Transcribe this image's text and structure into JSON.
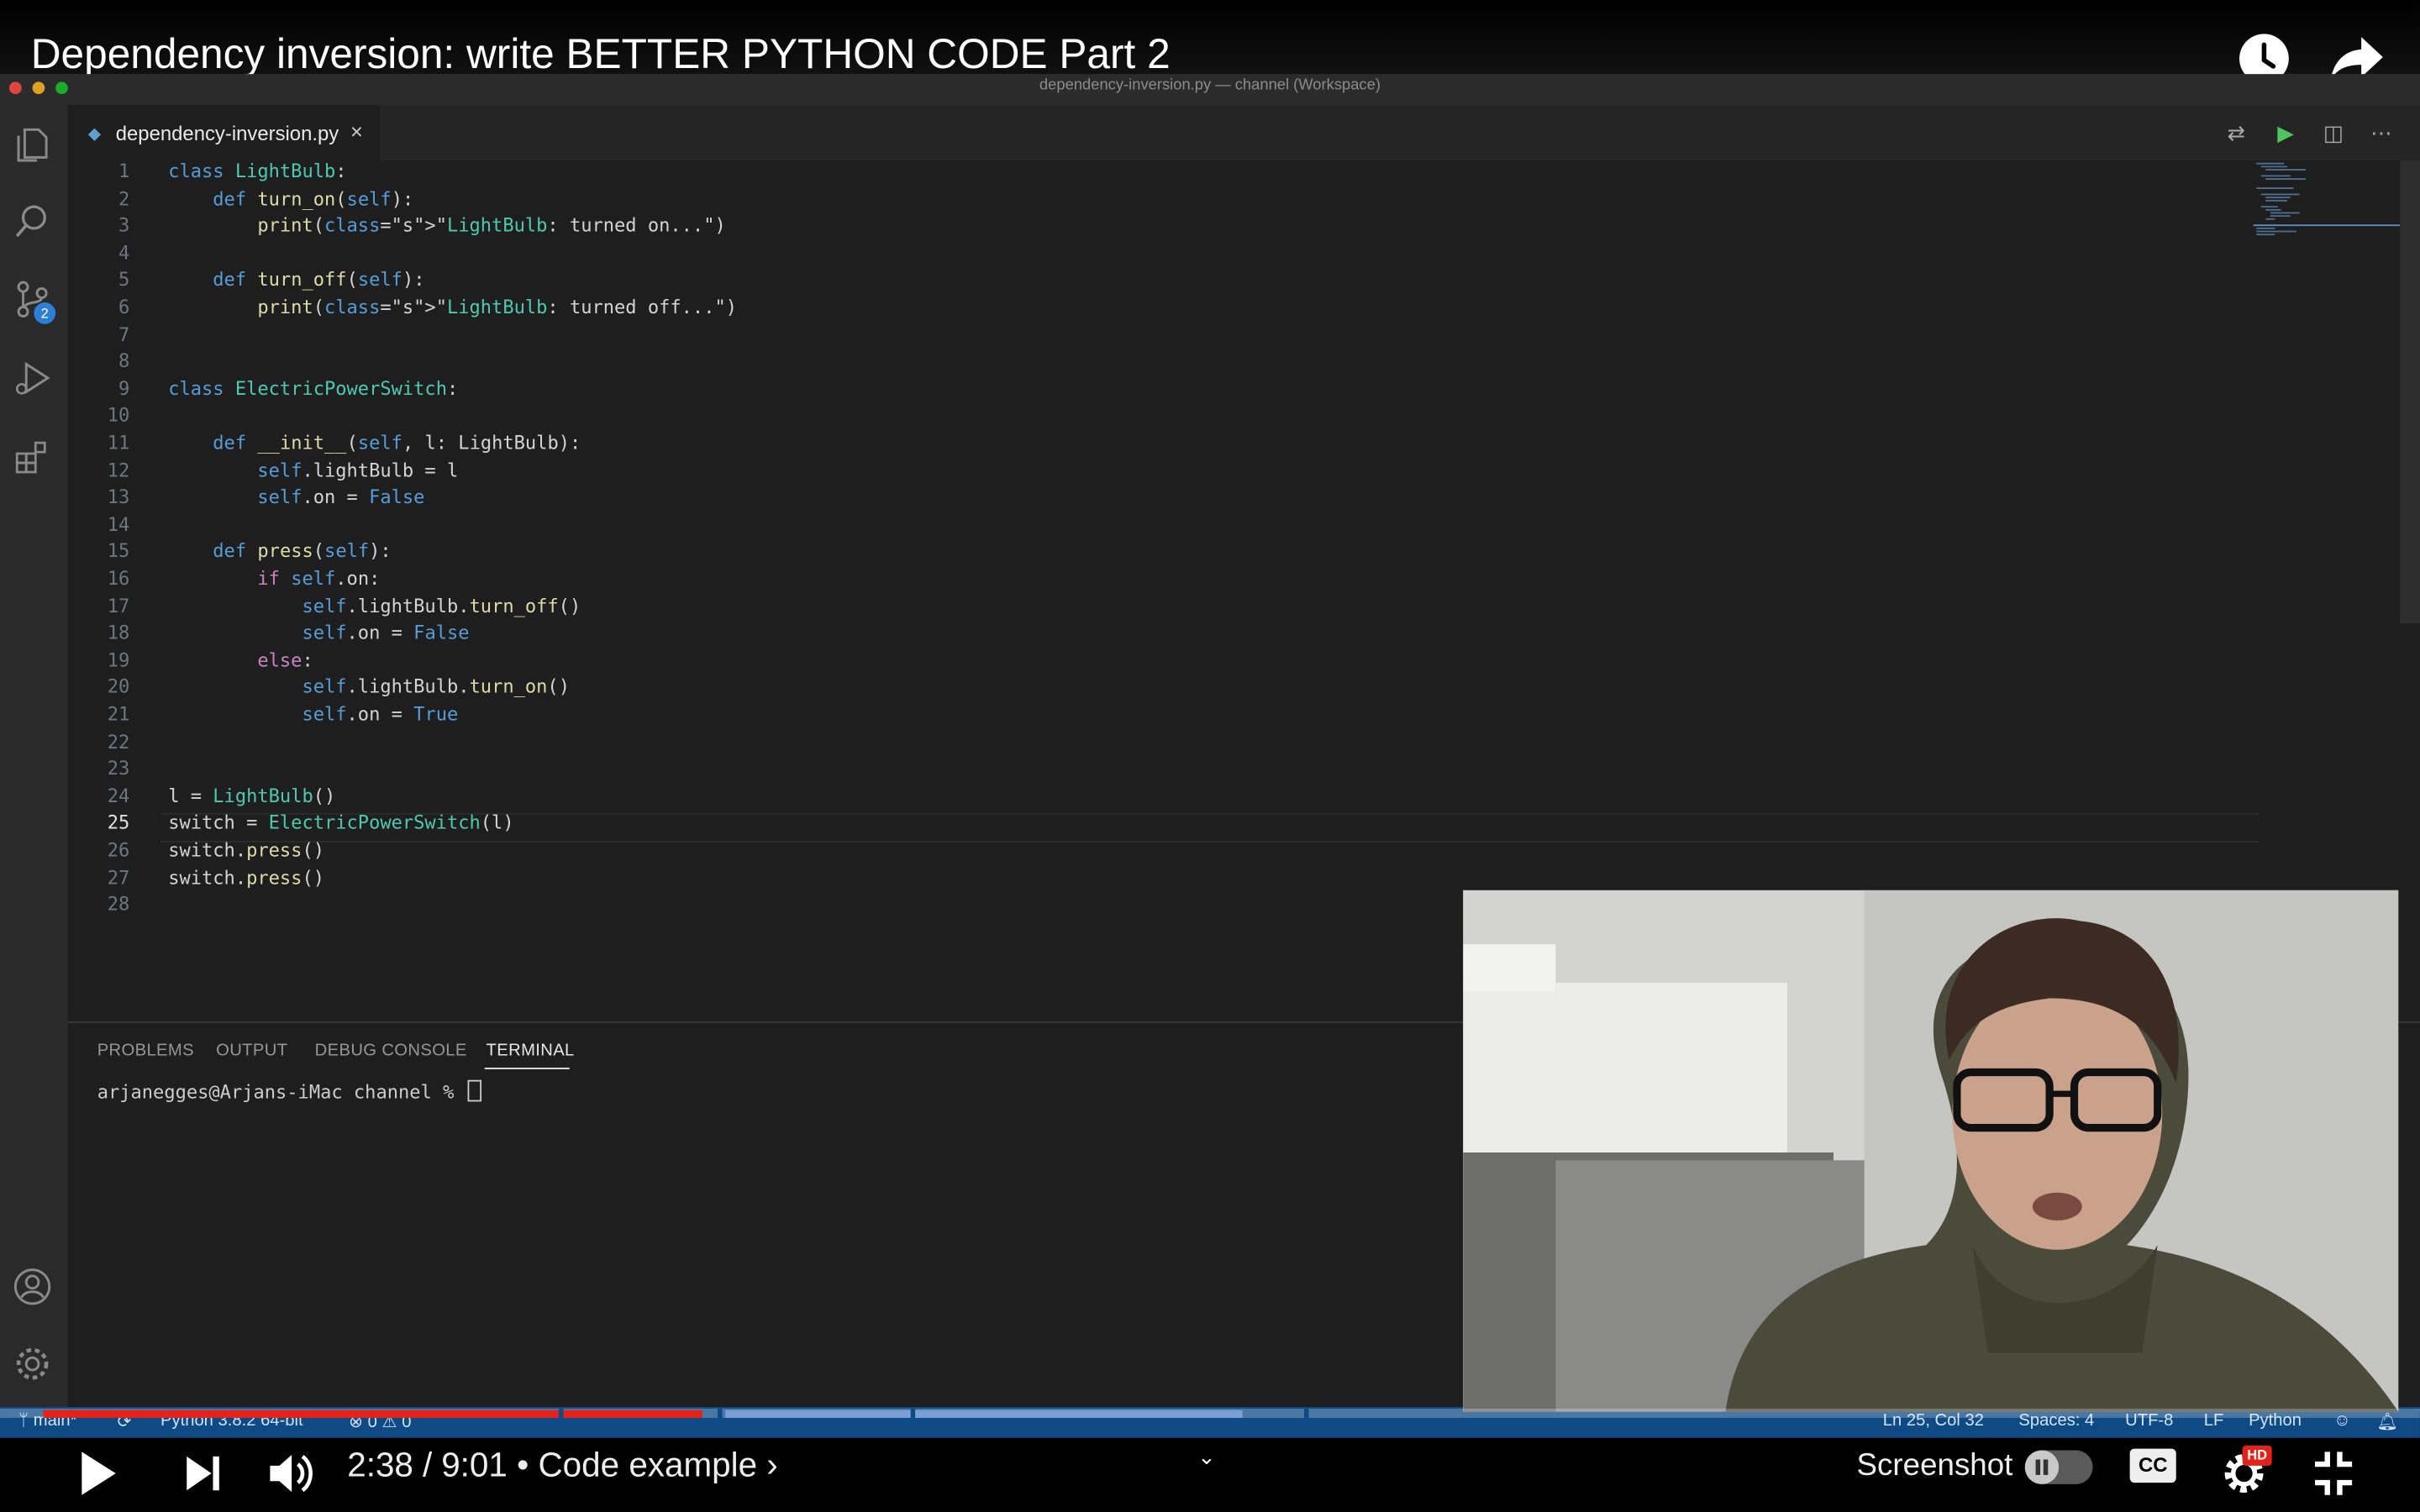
{
  "video": {
    "title": "Dependency inversion: write BETTER PYTHON CODE Part 2",
    "time_current": "2:38",
    "time_separator": "/",
    "time_total": "9:01",
    "chapter": "• Code example ›",
    "screenshot_label": "Screenshot",
    "cc_label": "CC",
    "hd_label": "HD",
    "progress_played": 0.29
  },
  "window": {
    "title": "dependency-inversion.py — channel (Workspace)"
  },
  "activity_bar": {
    "scm_badge": "2",
    "icons": [
      "files-icon",
      "search-icon",
      "source-control-icon",
      "run-debug-icon",
      "extensions-icon",
      "account-icon",
      "settings-gear-icon"
    ]
  },
  "editor": {
    "tab_label": "dependency-inversion.py",
    "tab_close": "×",
    "line_numbers": [
      "1",
      "2",
      "3",
      "4",
      "5",
      "6",
      "7",
      "8",
      "9",
      "10",
      "11",
      "12",
      "13",
      "14",
      "15",
      "16",
      "17",
      "18",
      "19",
      "20",
      "21",
      "22",
      "23",
      "24",
      "25",
      "26",
      "27",
      "28"
    ],
    "active_line": "25",
    "lines": [
      "class LightBulb:",
      "    def turn_on(self):",
      "        print(\"LightBulb: turned on...\")",
      "",
      "    def turn_off(self):",
      "        print(\"LightBulb: turned off...\")",
      "",
      "",
      "class ElectricPowerSwitch:",
      "",
      "    def __init__(self, l: LightBulb):",
      "        self.lightBulb = l",
      "        self.on = False",
      "",
      "    def press(self):",
      "        if self.on:",
      "            self.lightBulb.turn_off()",
      "            self.on = False",
      "        else:",
      "            self.lightBulb.turn_on()",
      "            self.on = True",
      "",
      "",
      "l = LightBulb()",
      "switch = ElectricPowerSwitch(l)",
      "switch.press()",
      "switch.press()",
      ""
    ]
  },
  "panel": {
    "tabs": [
      "PROBLEMS",
      "OUTPUT",
      "DEBUG CONSOLE",
      "TERMINAL"
    ],
    "active_tab": "TERMINAL",
    "terminal_prompt": "arjanegges@Arjans-iMac channel % "
  },
  "status_bar": {
    "branch": "main*",
    "interpreter": "Python 3.8.2 64-bit",
    "problems": "⊗ 0 ⚠ 0",
    "cursor_position": "Ln 25, Col 32",
    "indentation": "Spaces: 4",
    "encoding": "UTF-8",
    "eol": "LF",
    "language": "Python"
  },
  "colors": {
    "progress_red": "#e62117",
    "status_bar_blue": "#0f4a85",
    "editor_bg": "#1e1e1e"
  }
}
